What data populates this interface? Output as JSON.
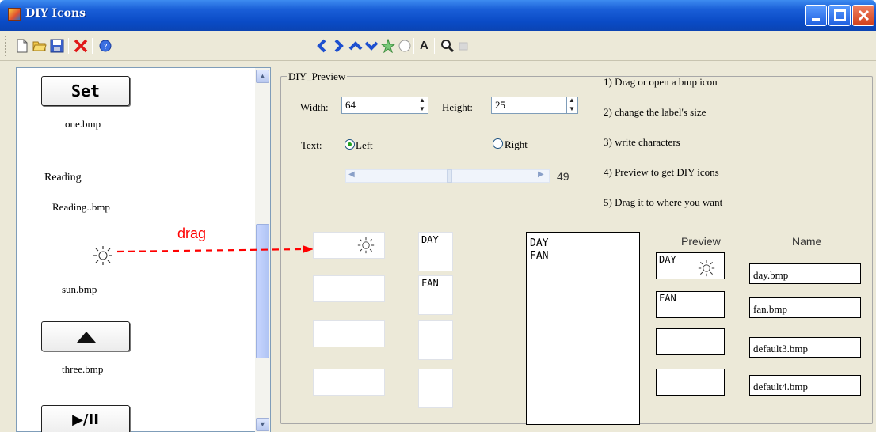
{
  "window": {
    "title": "DIY Icons"
  },
  "colors": {
    "titlebar": "#0a4bc6",
    "client": "#ece9d8",
    "arrow": "#ff0000",
    "toolbar_arrows": "#1d4fcf"
  },
  "toolbar": {
    "items": [
      "new-icon",
      "open-icon",
      "save-icon",
      "delete-icon",
      "help-icon",
      "arrow-left-icon",
      "arrow-right-icon",
      "arrow-up-icon",
      "arrow-down-icon",
      "star-icon",
      "circle-icon",
      "text-icon",
      "zoom-icon",
      "disabled-icon"
    ],
    "text_tool": "A"
  },
  "left_list": [
    {
      "button": "Set",
      "label": "one.bmp"
    },
    {
      "button": "Reading",
      "label": "Reading..bmp"
    },
    {
      "button": "sun-icon",
      "label": "sun.bmp"
    },
    {
      "button": "triangle-up-icon",
      "label": "three.bmp"
    },
    {
      "button": "▶/II",
      "label": ""
    }
  ],
  "annotation": {
    "drag_label": "drag"
  },
  "preview_group": {
    "legend": "DIY_Preview",
    "width_label": "Width:",
    "width_value": "64",
    "height_label": "Height:",
    "height_value": "25",
    "text_label": "Text:",
    "left_label": "Left",
    "right_label": "Right",
    "alignment": "Left",
    "slider_value": "49"
  },
  "instructions": [
    "1) Drag or open a bmp icon",
    "2) change the label's size",
    "3) write characters",
    "4) Preview to get DIY icons",
    "5) Drag it to where you want"
  ],
  "labels_col": [
    "DAY",
    "FAN",
    "",
    ""
  ],
  "textarea_lines": [
    "DAY",
    "FAN"
  ],
  "preview_header": "Preview",
  "name_header": "Name",
  "preview_items": [
    {
      "text": "DAY",
      "icon": "sun-icon",
      "name": "day.bmp"
    },
    {
      "text": "FAN",
      "icon": "",
      "name": "fan.bmp"
    },
    {
      "text": "",
      "icon": "",
      "name": "default3.bmp"
    },
    {
      "text": "",
      "icon": "",
      "name": "default4.bmp"
    }
  ]
}
